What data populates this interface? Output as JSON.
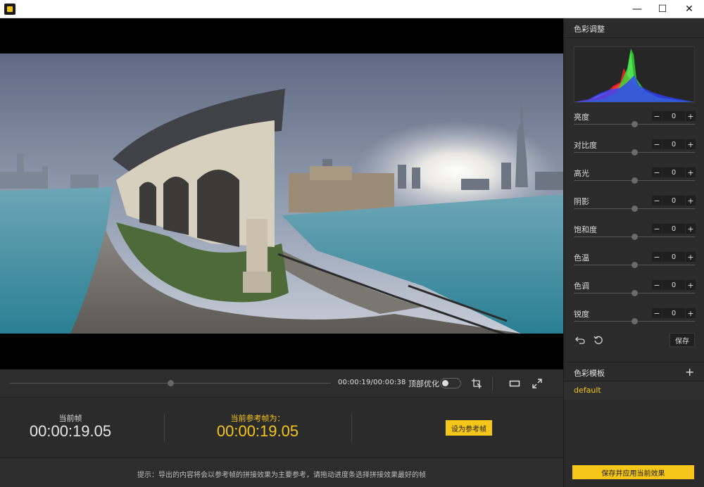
{
  "window": {
    "minimize_glyph": "—",
    "maximize_glyph": "☐",
    "close_glyph": "✕"
  },
  "timeline": {
    "progress": 0.5,
    "time_readout": "00:00:19/00:00:38",
    "top_optimize_label": "顶部优化",
    "top_optimize_on": false
  },
  "frame_info": {
    "current_label": "当前帧",
    "current_value": "00:00:19.05",
    "ref_label": "当前参考帧为：",
    "ref_value": "00:00:19.05",
    "set_ref_button": "设为参考帧"
  },
  "hint": "提示：导出的内容将会以参考帧的拼接效果为主要参考，请拖动进度条选择拼接效果最好的帧",
  "color_panel": {
    "title": "色彩调整",
    "adjustments": [
      {
        "label": "亮度",
        "value": "0",
        "position": 0.5
      },
      {
        "label": "对比度",
        "value": "0",
        "position": 0.5
      },
      {
        "label": "高光",
        "value": "0",
        "position": 0.5
      },
      {
        "label": "阴影",
        "value": "0",
        "position": 0.5
      },
      {
        "label": "饱和度",
        "value": "0",
        "position": 0.5
      },
      {
        "label": "色温",
        "value": "0",
        "position": 0.5
      },
      {
        "label": "色调",
        "value": "0",
        "position": 0.5
      },
      {
        "label": "锐度",
        "value": "0",
        "position": 0.5
      }
    ],
    "minus_glyph": "−",
    "plus_glyph": "+",
    "save_button": "保存"
  },
  "templates": {
    "title": "色彩模板",
    "add_glyph": "+",
    "items": [
      "default"
    ]
  },
  "apply_button": "保存并应用当前效果",
  "colors": {
    "accent": "#f5c518",
    "panel_bg": "#2b2b2b"
  }
}
